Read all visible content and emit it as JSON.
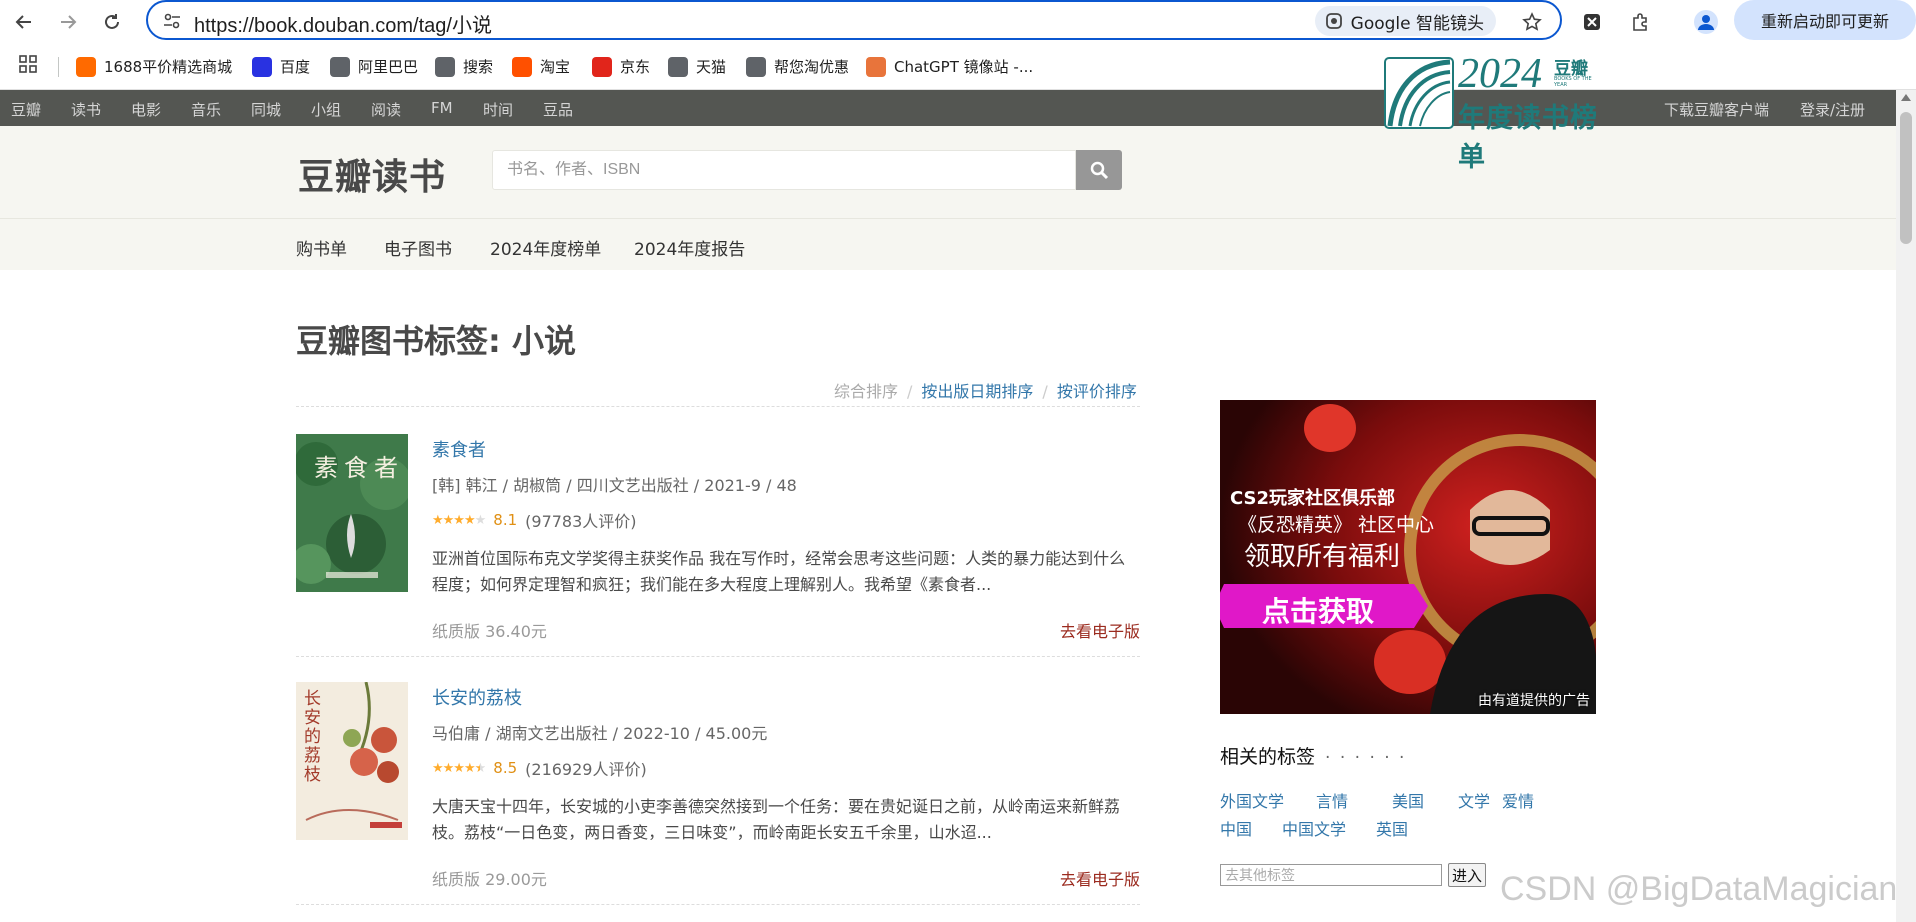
{
  "browser": {
    "url": "https://book.douban.com/tag/小说",
    "lens_label": "Google 智能镜头",
    "update_label": "重新启动即可更新"
  },
  "bookmarks": [
    {
      "label": "1688平价精选商城",
      "color": "#ff6a00"
    },
    {
      "label": "百度",
      "color": "#2932e1"
    },
    {
      "label": "阿里巴巴",
      "color": "#5f6368"
    },
    {
      "label": "搜索",
      "color": "#5f6368"
    },
    {
      "label": "淘宝",
      "color": "#ff5000"
    },
    {
      "label": "京东",
      "color": "#e1251b"
    },
    {
      "label": "天猫",
      "color": "#5f6368"
    },
    {
      "label": "帮您淘优惠",
      "color": "#5f6368"
    },
    {
      "label": "ChatGPT 镜像站 -...",
      "color": "#e8743b"
    }
  ],
  "global_nav": {
    "items": [
      "豆瓣",
      "读书",
      "电影",
      "音乐",
      "同城",
      "小组",
      "阅读",
      "FM",
      "时间",
      "豆品"
    ],
    "download": "下载豆瓣客户端",
    "login": "登录/注册"
  },
  "header": {
    "logo": "豆瓣读书",
    "search_placeholder": "书名、作者、ISBN",
    "badge_year": "2024",
    "badge_brand": "豆瓣",
    "badge_sub": "BOOKS OF THE YEAR",
    "badge_title": "年度读书榜单"
  },
  "subnav": [
    "购书单",
    "电子图书",
    "2024年度榜单",
    "2024年度报告"
  ],
  "main": {
    "title": "豆瓣图书标签: 小说",
    "sort": {
      "current": "综合排序",
      "by_date": "按出版日期排序",
      "by_rating": "按评价排序"
    }
  },
  "books": [
    {
      "title": "素食者",
      "pub": "[韩] 韩江 / 胡椒筒 / 四川文艺出版社 / 2021-9 / 48",
      "stars": 4,
      "score": "8.1",
      "votes": "(97783人评价)",
      "desc": "亚洲首位国际布克文学奖得主获奖作品 我在写作时，经常会思考这些问题：人类的暴力能达到什么程度；如何界定理智和疯狂；我们能在多大程度上理解别人。我希望《素食者...",
      "price": "纸质版 36.40元",
      "ebook": "去看电子版",
      "cover_text": "素食者"
    },
    {
      "title": "长安的荔枝",
      "pub": "马伯庸 / 湖南文艺出版社 / 2022-10 / 45.00元",
      "stars": 4.5,
      "score": "8.5",
      "votes": "(216929人评价)",
      "desc": "大唐天宝十四年，长安城的小吏李善德突然接到一个任务：要在贵妃诞日之前，从岭南运来新鲜荔枝。荔枝“一日色变，两日香变，三日味变”，而岭南距长安五千余里，山水迢...",
      "price": "纸质版 29.00元",
      "ebook": "去看电子版",
      "cover_text": "长安的荔枝"
    }
  ],
  "sidebar": {
    "ad": {
      "line1": "CS2玩家社区俱乐部",
      "line2": "《反恐精英》 社区中心",
      "line3": "领取所有福利",
      "cta": "点击获取",
      "caption": "由有道提供的广告"
    },
    "tags_title": "相关的标签",
    "tags_dots": "· · · · · ·",
    "tags": [
      "外国文学",
      "言情",
      "美国",
      "文学",
      "爱情",
      "中国",
      "中国文学",
      "英国"
    ],
    "tag_placeholder": "去其他标签",
    "tag_go": "进入"
  },
  "watermark": "CSDN @BigDataMagician"
}
